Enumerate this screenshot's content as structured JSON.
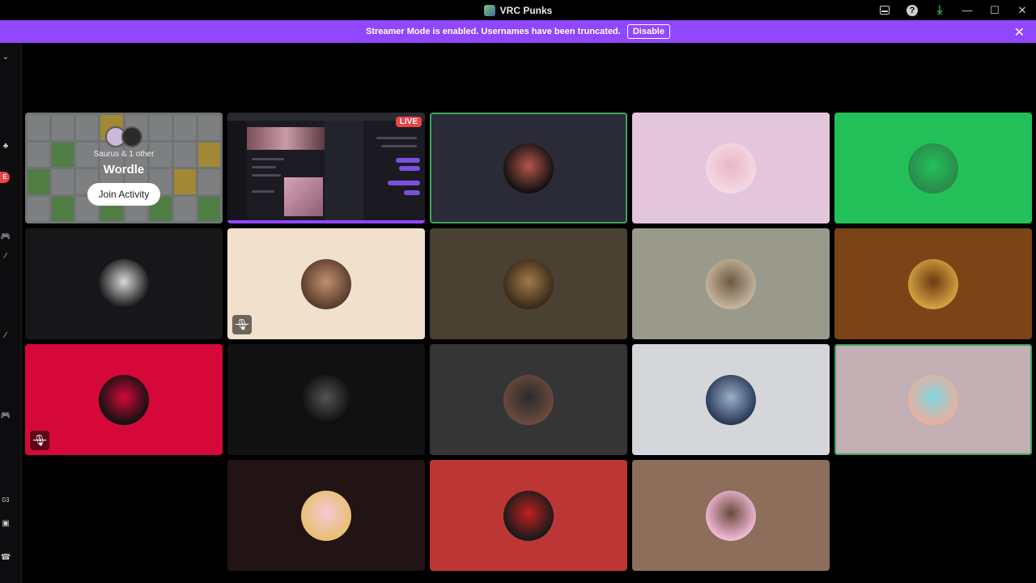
{
  "window": {
    "title": "VRC Punks"
  },
  "banner": {
    "text": "Streamer Mode is enabled. Usernames have been truncated.",
    "button": "Disable",
    "close": "✕",
    "color": "#9146ff"
  },
  "titlebar": {
    "minimize": "—",
    "maximize": "☐",
    "close": "✕"
  },
  "activity": {
    "participants": "Saurus & 1 other",
    "name": "Wordle",
    "join": "Join Activity"
  },
  "stream": {
    "live": "LIVE"
  },
  "left_strip": {
    "live": "E",
    "numbers": "03"
  },
  "tiles": [
    {
      "bg": "#2b2a37",
      "avatar": [
        "#111",
        "#b5564a"
      ],
      "speaking": true
    },
    {
      "bg": "#e4c6dc",
      "avatar": [
        "#f3d9e4",
        "#e9b6c6"
      ],
      "speaking": false
    },
    {
      "bg": "#23c05a",
      "avatar": [
        "#2a8a4a",
        "#23c05a"
      ],
      "speaking": false
    },
    {
      "bg": "#17171a",
      "avatar": [
        "#17171a",
        "#d8d8d8"
      ],
      "speaking": false
    },
    {
      "bg": "#f0e0cc",
      "avatar": [
        "#5a3b2c",
        "#c09070"
      ],
      "speaking": false,
      "muted": true
    },
    {
      "bg": "#4b4133",
      "avatar": [
        "#3a2a1a",
        "#a07a48"
      ],
      "speaking": false
    },
    {
      "bg": "#9a9a8c",
      "avatar": [
        "#c5b49c",
        "#6d5a44"
      ],
      "speaking": false
    },
    {
      "bg": "#7a4416",
      "avatar": [
        "#d4a040",
        "#6b3a12"
      ],
      "speaking": false
    },
    {
      "bg": "#d6083a",
      "avatar": [
        "#111",
        "#d6083a"
      ],
      "speaking": false,
      "muted": true
    },
    {
      "bg": "#111111",
      "avatar": [
        "#0d0d0d",
        "#555"
      ],
      "speaking": false
    },
    {
      "bg": "#353535",
      "avatar": [
        "#6a4a3c",
        "#2a2a2a"
      ],
      "speaking": false
    },
    {
      "bg": "#d4d6d9",
      "avatar": [
        "#2a3a5a",
        "#9ab0c8"
      ],
      "speaking": false
    },
    {
      "bg": "#c2b0b4",
      "avatar": [
        "#e9b0a0",
        "#7fd6e0"
      ],
      "speaking": true
    },
    {
      "bg": "#221414",
      "avatar": [
        "#e8c070",
        "#f4c8d8"
      ],
      "speaking": false
    },
    {
      "bg": "#bd3636",
      "avatar": [
        "#1a1a1a",
        "#c02020"
      ],
      "speaking": false
    },
    {
      "bg": "#8c6e5a",
      "avatar": [
        "#f0b8d8",
        "#6a4a3a"
      ],
      "speaking": false
    }
  ]
}
